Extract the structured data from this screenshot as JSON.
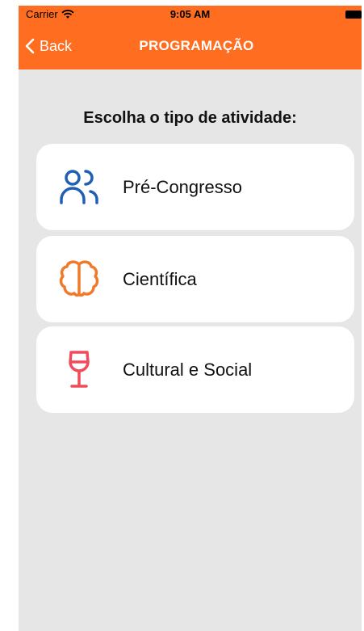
{
  "status_bar": {
    "carrier": "Carrier",
    "time": "9:05 AM"
  },
  "nav": {
    "back_label": "Back",
    "title": "PROGRAMAÇÃO"
  },
  "prompt": "Escolha o tipo de atividade:",
  "options": [
    {
      "label": "Pré-Congresso",
      "icon": "users-icon",
      "color": "#1f5fb4"
    },
    {
      "label": "Científica",
      "icon": "brain-icon",
      "color": "#f07a2a"
    },
    {
      "label": "Cultural e Social",
      "icon": "wine-glass-icon",
      "color": "#ef4b5a"
    }
  ],
  "colors": {
    "accent": "#ff6e20",
    "background": "#e6e6e6",
    "card": "#ffffff"
  }
}
